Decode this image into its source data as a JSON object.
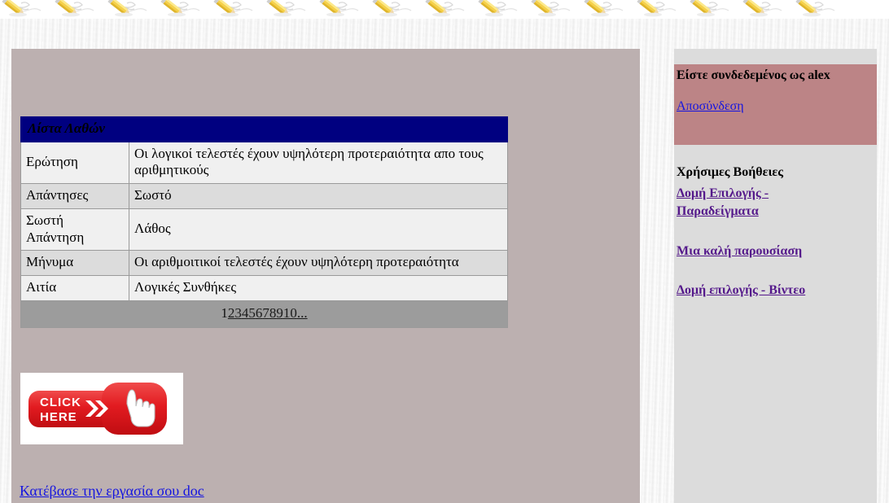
{
  "banner": {
    "icon": "pencil-drawing-icon",
    "tile_count": 17
  },
  "colors": {
    "page_background": "#f3f3f3",
    "content_panel": "#bcb0b0",
    "sidebar": "#dcdcdc",
    "login_box": "#bc8486",
    "table_header": "#000080",
    "table_row_light": "#f0f0f0",
    "table_row_dark": "#dcdcdc",
    "pager_row": "#9c9c9c",
    "link_blue": "#1414e0",
    "link_visited_purple": "#551a8b",
    "button_red": "#e3191e"
  },
  "main": {
    "table": {
      "title": "Λίστα Λαθών",
      "rows": [
        {
          "label": "Ερώτηση",
          "value": "Οι λογικοί τελεστές έχουν υψηλότερη προτεραιότητα απο τους αριθμητικούς"
        },
        {
          "label": "Απάντησες",
          "value": "Σωστό"
        },
        {
          "label": "Σωστή Απάντηση",
          "value": "Λάθος"
        },
        {
          "label": "Μήνυμα",
          "value": "Οι αριθμοιτικοί τελεστές έχουν υψηλότερη προτεραιότητα"
        },
        {
          "label": "Αιτία",
          "value": "Λογικές Συνθήκες"
        }
      ],
      "pagination": {
        "current": "1",
        "links": [
          "2",
          "3",
          "4",
          "5",
          "6",
          "7",
          "8",
          "9",
          "10",
          "..."
        ]
      }
    },
    "click_here_button": {
      "line1": "CLICK",
      "line2": "HERE",
      "icon": "pointing-hand-icon"
    },
    "download_link": "Κατέβασε την εργασία σου doc"
  },
  "sidebar": {
    "login_status": "Είστε συνδεδεμένος ως alex",
    "logout_label": "Αποσύνδεση",
    "helps_heading": "Χρήσιμες Βοήθειες",
    "help_links": [
      "Δομή Επιλογής - Παραδείγματα",
      "Μια καλή παρουσίαση",
      "Δομή επιλογής - Βίντεο"
    ]
  }
}
